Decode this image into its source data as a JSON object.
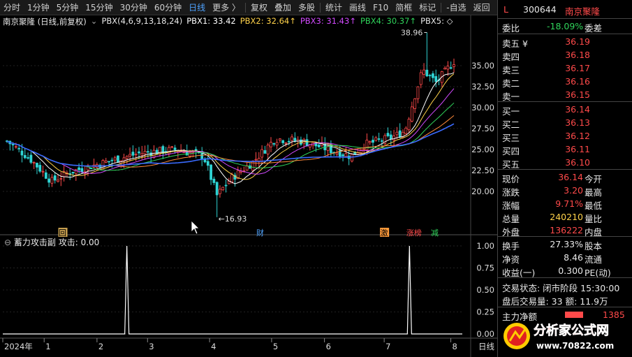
{
  "toolbar": {
    "items": [
      "分时",
      "1分钟",
      "5分钟",
      "15分钟",
      "30分钟",
      "60分钟",
      "日线",
      "更多 〉",
      "复权",
      "叠加",
      "多股",
      "统计",
      "画线",
      "F10",
      "简框",
      "标记",
      "-自选",
      "返回"
    ],
    "active_index": 6
  },
  "legend": {
    "title": "南京聚隆 (日线,前复权)",
    "indicator": "PBX(4,6,9,13,18,24)",
    "pbx1": "PBX1: 33.42",
    "pbx2": "PBX2: 32.64↑",
    "pbx3": "PBX3: 31.43↑",
    "pbx4": "PBX4: 30.37↑",
    "pbx5": "PBX5: ◇"
  },
  "colors": {
    "up": "#ff4a4a",
    "down": "#2fd3d3",
    "pbx1": "#ffffff",
    "pbx2": "#ffd24a",
    "pbx3": "#d24aff",
    "pbx4": "#2fd35a",
    "pbx5": "#3a6bff",
    "pbx6": "#ff8a3a"
  },
  "price_axis": [
    "35.00",
    "32.50",
    "30.00",
    "27.50",
    "25.00",
    "22.50",
    "20.00"
  ],
  "annotations": {
    "high": "38.96",
    "low": "←16.93",
    "marks": [
      "回",
      "财",
      "激",
      "涨榜",
      "减"
    ]
  },
  "indicator_panel": {
    "title": "蓄力攻击副  攻击: 0.00",
    "axis": [
      "1.00",
      "0.75",
      "0.50",
      "0.25",
      "0.00"
    ]
  },
  "time_axis": [
    "2024年",
    "1",
    "2",
    "3",
    "4",
    "5",
    "6",
    "7",
    "8",
    "日线"
  ],
  "quote": {
    "marker": "L",
    "code": "300644",
    "name": "南京聚隆",
    "weibi_label": "委比",
    "weibi_value": "-18.09%",
    "weicha_label": "委差",
    "asks": [
      {
        "label": "卖五 ¥",
        "price": "36.19"
      },
      {
        "label": "卖四",
        "price": "36.18"
      },
      {
        "label": "卖三",
        "price": "36.17"
      },
      {
        "label": "卖二",
        "price": "36.16"
      },
      {
        "label": "卖一",
        "price": "36.15"
      }
    ],
    "bids": [
      {
        "label": "买一",
        "price": "36.14"
      },
      {
        "label": "买二",
        "price": "36.13"
      },
      {
        "label": "买三",
        "price": "36.12"
      },
      {
        "label": "买四",
        "price": "36.11"
      },
      {
        "label": "买五",
        "price": "36.10"
      }
    ],
    "stats": [
      {
        "l": "现价",
        "v": "36.14",
        "r": "今开"
      },
      {
        "l": "涨跌",
        "v": "3.20",
        "r": "最高"
      },
      {
        "l": "涨幅",
        "v": "9.71%",
        "r": "最低"
      },
      {
        "l": "总量",
        "v": "240210",
        "r": "量比"
      },
      {
        "l": "外盘",
        "v": "136222",
        "r": "内盘"
      }
    ],
    "stats2": [
      {
        "l": "换手",
        "v": "27.33%",
        "r": "股本"
      },
      {
        "l": "净资",
        "v": "8.46",
        "r": "流通"
      },
      {
        "l": "收益(一)",
        "v": "0.300",
        "r": "PE(动)"
      }
    ],
    "trade_status": "交易状态: 闭市阶段 15:30:00",
    "after_hours": "盘后交易量: 33  额: 11.9万",
    "main_flow_label": "主力净额",
    "main_flow_value": "1385"
  },
  "watermark": {
    "brand": "分析家公式网",
    "url": "www.70822.com"
  }
}
